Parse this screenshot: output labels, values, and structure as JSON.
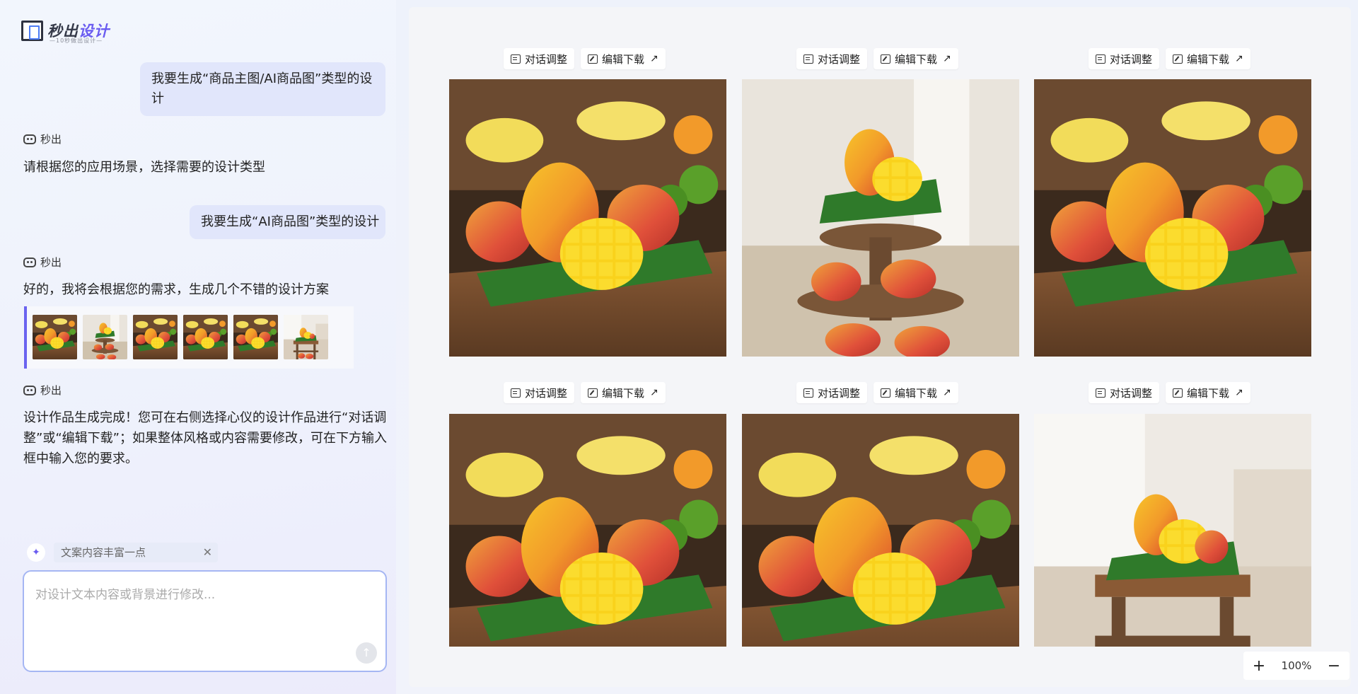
{
  "brand": {
    "name_dark": "秒出",
    "name_accent": "设计",
    "tagline": "—10秒做出设计—"
  },
  "chat": {
    "messages": [
      {
        "role": "user",
        "text": "我要生成“商品主图/AI商品图”类型的设计"
      },
      {
        "role": "bot",
        "name": "秒出",
        "text": "请根据您的应用场景，选择需要的设计类型"
      },
      {
        "role": "user",
        "text": "我要生成“AI商品图”类型的设计"
      },
      {
        "role": "bot",
        "name": "秒出",
        "text": "好的，我将会根据您的需求，生成几个不错的设计方案"
      },
      {
        "role": "bot",
        "name": "秒出",
        "text": "设计作品生成完成！您可在右侧选择心仪的设计作品进行“对话调整”或“编辑下载”；如果整体风格或内容需要修改，可在下方输入框中输入您的要求。"
      }
    ],
    "suggestion": "文案内容丰富一点",
    "input_placeholder": "对设计文本内容或背景进行修改...",
    "input_value": ""
  },
  "toolbar": {
    "chat_adjust": "对话调整",
    "edit_download": "编辑下载"
  },
  "watermark": "秒出设计",
  "designs": [
    {
      "id": 1,
      "scene": "crate"
    },
    {
      "id": 2,
      "scene": "tiered-stand"
    },
    {
      "id": 3,
      "scene": "crate"
    },
    {
      "id": 4,
      "scene": "crate"
    },
    {
      "id": 5,
      "scene": "crate"
    },
    {
      "id": 6,
      "scene": "kitchen-stand"
    }
  ],
  "zoom": {
    "level": "100%",
    "plus": "+",
    "minus": "−"
  },
  "colors": {
    "accent": "#6a5cf0",
    "bubble": "#e1e6fb",
    "input_border": "#a5b6f3"
  }
}
